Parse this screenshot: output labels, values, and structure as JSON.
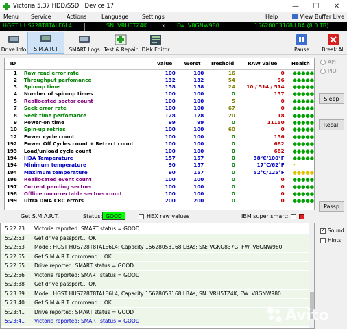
{
  "window": {
    "title": "Victoria 5.37 HDD/SSD | Device 17",
    "minimize": "—",
    "maximize": "☐",
    "close": "✕"
  },
  "menu": {
    "items": [
      "Menu",
      "Service",
      "Actions",
      "Language",
      "Settings",
      "Help"
    ],
    "view_buffer": "View Buffer Live"
  },
  "device": {
    "model": "HGST HUS728T8TALE6L4",
    "sn": "SN: VRH5TZ4K",
    "x": "x",
    "fw": "Fw: V8GNW980",
    "lba": "15628053168 LBA (8.0 TB)"
  },
  "toolbar": {
    "buttons": [
      "Drive Info",
      "S.M.A.R.T",
      "SMART Logs",
      "Test & Repair",
      "Disk Editor",
      "Pause",
      "Break All"
    ],
    "active": "S.M.A.R.T"
  },
  "smart_table": {
    "headers": [
      "ID",
      "",
      "Value",
      "Worst",
      "Treshold",
      "RAW value",
      "Health"
    ],
    "rows": [
      {
        "id": "1",
        "name": "Raw read error rate",
        "value": "100",
        "worst": "100",
        "thr": "16",
        "raw": "0",
        "health": "●●●●●",
        "nclass": "n-green",
        "rclass": "r-red",
        "hclass": "dot-green"
      },
      {
        "id": "2",
        "name": "Throughput perfomance",
        "value": "132",
        "worst": "132",
        "thr": "54",
        "raw": "96",
        "health": "●●●●●",
        "nclass": "n-green",
        "rclass": "r-red",
        "hclass": "dot-green"
      },
      {
        "id": "3",
        "name": "Spin-up time",
        "value": "158",
        "worst": "158",
        "thr": "24",
        "raw": "10 / 514 / 514",
        "health": "●●●●●",
        "nclass": "n-green",
        "rclass": "r-red",
        "hclass": "dot-green"
      },
      {
        "id": "4",
        "name": "Number of spin-up times",
        "value": "100",
        "worst": "100",
        "thr": "0",
        "raw": "157",
        "health": "●●●●●",
        "nclass": "n-black",
        "rclass": "r-red",
        "hclass": "dot-green"
      },
      {
        "id": "5",
        "name": "Reallocated sector count",
        "value": "100",
        "worst": "100",
        "thr": "5",
        "raw": "0",
        "health": "●●●●●",
        "nclass": "n-purple",
        "rclass": "r-red",
        "hclass": "dot-green"
      },
      {
        "id": "7",
        "name": "Seek error rate",
        "value": "100",
        "worst": "100",
        "thr": "67",
        "raw": "0",
        "health": "●●●●●",
        "nclass": "n-green",
        "rclass": "r-red",
        "hclass": "dot-green"
      },
      {
        "id": "8",
        "name": "Seek time perfomance",
        "value": "128",
        "worst": "128",
        "thr": "20",
        "raw": "18",
        "health": "●●●●●",
        "nclass": "n-green",
        "rclass": "r-red",
        "hclass": "dot-green"
      },
      {
        "id": "9",
        "name": "Power-on time",
        "value": "99",
        "worst": "99",
        "thr": "0",
        "raw": "11150",
        "health": "●●●●●",
        "nclass": "n-black",
        "rclass": "r-red",
        "hclass": "dot-green"
      },
      {
        "id": "10",
        "name": "Spin-up retries",
        "value": "100",
        "worst": "100",
        "thr": "60",
        "raw": "0",
        "health": "●●●●●",
        "nclass": "n-green",
        "rclass": "r-red",
        "hclass": "dot-green"
      },
      {
        "id": "12",
        "name": "Power cycle count",
        "value": "100",
        "worst": "100",
        "thr": "0",
        "raw": "156",
        "health": "●●●●●",
        "nclass": "n-black",
        "rclass": "r-red",
        "hclass": "dot-green"
      },
      {
        "id": "192",
        "name": "Power Off Cycles count + Retract count",
        "value": "100",
        "worst": "100",
        "thr": "0",
        "raw": "682",
        "health": "●●●●●",
        "nclass": "n-black",
        "rclass": "r-red",
        "hclass": "dot-green"
      },
      {
        "id": "193",
        "name": "Load/unload cycle count",
        "value": "100",
        "worst": "100",
        "thr": "0",
        "raw": "682",
        "health": "●●●●●",
        "nclass": "n-black",
        "rclass": "r-red",
        "hclass": "dot-green"
      },
      {
        "id": "194",
        "name": "HDA Temperature",
        "value": "157",
        "worst": "157",
        "thr": "0",
        "raw": "38°C/100°F",
        "health": "●●●●●",
        "nclass": "n-blue",
        "rclass": "r-blue",
        "hclass": "dot-green"
      },
      {
        "id": "194",
        "name": "Minimum temperature",
        "value": "90",
        "worst": "157",
        "thr": "0",
        "raw": "17°C/62°F",
        "health": "•",
        "nclass": "n-blue",
        "rclass": "r-blue",
        "hclass": "dot-yellow"
      },
      {
        "id": "194",
        "name": "Maximum temperature",
        "value": "90",
        "worst": "157",
        "thr": "0",
        "raw": "52°C/125°F",
        "health": "●●●●●",
        "nclass": "n-blue",
        "rclass": "r-blue",
        "hclass": "dot-yellow"
      },
      {
        "id": "196",
        "name": "Reallocated event count",
        "value": "100",
        "worst": "100",
        "thr": "0",
        "raw": "0",
        "health": "●●●●●",
        "nclass": "n-purple",
        "rclass": "r-red",
        "hclass": "dot-green"
      },
      {
        "id": "197",
        "name": "Current pending sectors",
        "value": "100",
        "worst": "100",
        "thr": "0",
        "raw": "0",
        "health": "●●●●●",
        "nclass": "n-purple",
        "rclass": "r-red",
        "hclass": "dot-green"
      },
      {
        "id": "198",
        "name": "Offline uncorrectable sectors count",
        "value": "100",
        "worst": "100",
        "thr": "0",
        "raw": "0",
        "health": "●●●●●",
        "nclass": "n-purple",
        "rclass": "r-red",
        "hclass": "dot-green"
      },
      {
        "id": "199",
        "name": "Ultra DMA CRC errors",
        "value": "200",
        "worst": "200",
        "thr": "0",
        "raw": "0",
        "health": "●●●●●",
        "nclass": "n-black",
        "rclass": "r-red",
        "hclass": "dot-green"
      }
    ]
  },
  "right_panel": {
    "api": "API",
    "pio": "PIO",
    "sleep": "Sleep",
    "recall": "Recall",
    "passp": "Passp"
  },
  "status_strip": {
    "get_smart": "Get S.M.A.R.T.",
    "status_label": "Status:",
    "status_value": "GOOD",
    "hex_raw": "HEX raw values",
    "ibm": "IBM super smart:"
  },
  "log": {
    "rows": [
      {
        "time": "5:22:23",
        "msg": "Victoria reported: SMART status = GOOD",
        "style": ""
      },
      {
        "time": "5:22:53",
        "msg": "Get drive passport... OK",
        "style": "alt"
      },
      {
        "time": "5:22:53",
        "msg": "Model: HGST HUS728T8TALE6L4; Capacity 15628053168 LBAs; SN: VGKG837G; FW: V8GNW980",
        "style": "alt"
      },
      {
        "time": "5:22:55",
        "msg": "Get S.M.A.R.T. command... OK",
        "style": "alt"
      },
      {
        "time": "5:22:55",
        "msg": "Drive reported: SMART status = GOOD",
        "style": "alt"
      },
      {
        "time": "5:22:56",
        "msg": "Victoria reported: SMART status = GOOD",
        "style": "alt"
      },
      {
        "time": "5:23:38",
        "msg": "Get drive passport... OK",
        "style": "alt"
      },
      {
        "time": "5:23:39",
        "msg": "Model: HGST HUS728T8TALE6L4; Capacity 15628053168 LBAs; SN: VRH5TZ4K; FW: V8GNW980",
        "style": "alt"
      },
      {
        "time": "5:23:40",
        "msg": "Get S.M.A.R.T. command... OK",
        "style": "alt"
      },
      {
        "time": "5:23:41",
        "msg": "Drive reported: SMART status = GOOD",
        "style": "alt"
      },
      {
        "time": "5:23:41",
        "msg": "Victoria reported: SMART status = GOOD",
        "style": "blue"
      }
    ]
  },
  "log_options": {
    "sound": "Sound",
    "hints": "Hints"
  },
  "watermark": "Avito",
  "colors": {
    "status_good": "#00ff00",
    "device_bar_bg": "#000000",
    "device_bar_text": "#00e000"
  }
}
